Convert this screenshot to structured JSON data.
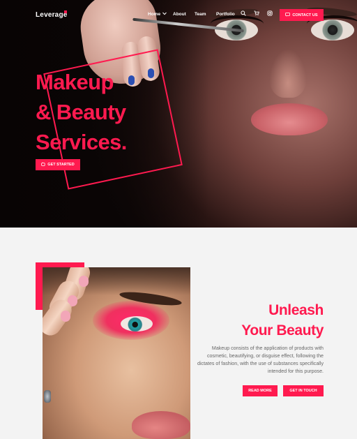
{
  "nav": {
    "logo": "Leverage",
    "items": [
      {
        "label": "Home",
        "has_dropdown": true
      },
      {
        "label": "About"
      },
      {
        "label": "Team"
      },
      {
        "label": "Portfolio"
      }
    ],
    "icons": [
      "search-icon",
      "cart-icon",
      "instagram-icon"
    ],
    "contact_label": "CONTACT US"
  },
  "hero": {
    "headline_lines": [
      "Makeup",
      "& Beauty",
      "Services."
    ],
    "cta_label": "GET STARTED"
  },
  "about": {
    "title_lines": [
      "Unleash",
      "Your Beauty"
    ],
    "description": "Makeup consists of the application of products with cosmetic, beautifying, or disguise effect, following the dictates of fashion, with the use of substances specifically intended for this purpose.",
    "read_more_label": "READ MORE",
    "get_in_touch_label": "GET IN TOUCH"
  },
  "colors": {
    "accent": "#ff1a4f",
    "page_background": "#f3f3f3",
    "text_muted": "#666666"
  }
}
